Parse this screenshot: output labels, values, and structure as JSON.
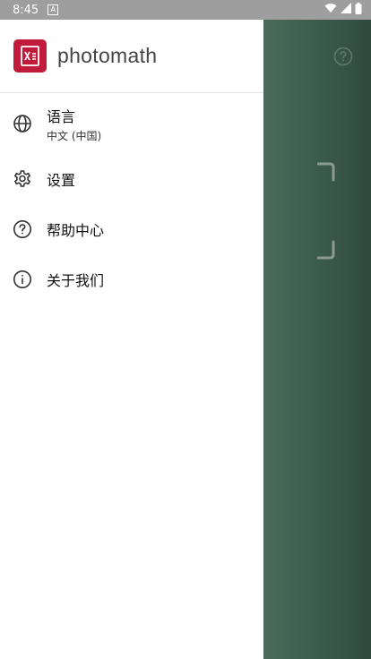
{
  "status": {
    "time": "8:45",
    "badge": "A"
  },
  "brand": {
    "name": "photomath"
  },
  "menu": [
    {
      "label": "语言",
      "sublabel": "中文 (中国)",
      "icon": "globe-icon"
    },
    {
      "label": "设置",
      "icon": "gear-icon"
    },
    {
      "label": "帮助中心",
      "icon": "help-circle-icon"
    },
    {
      "label": "关于我们",
      "icon": "info-icon"
    }
  ],
  "colors": {
    "brand": "#c11b3c",
    "statusbar": "#9e9e9e",
    "camera": "#3f5a4d"
  }
}
